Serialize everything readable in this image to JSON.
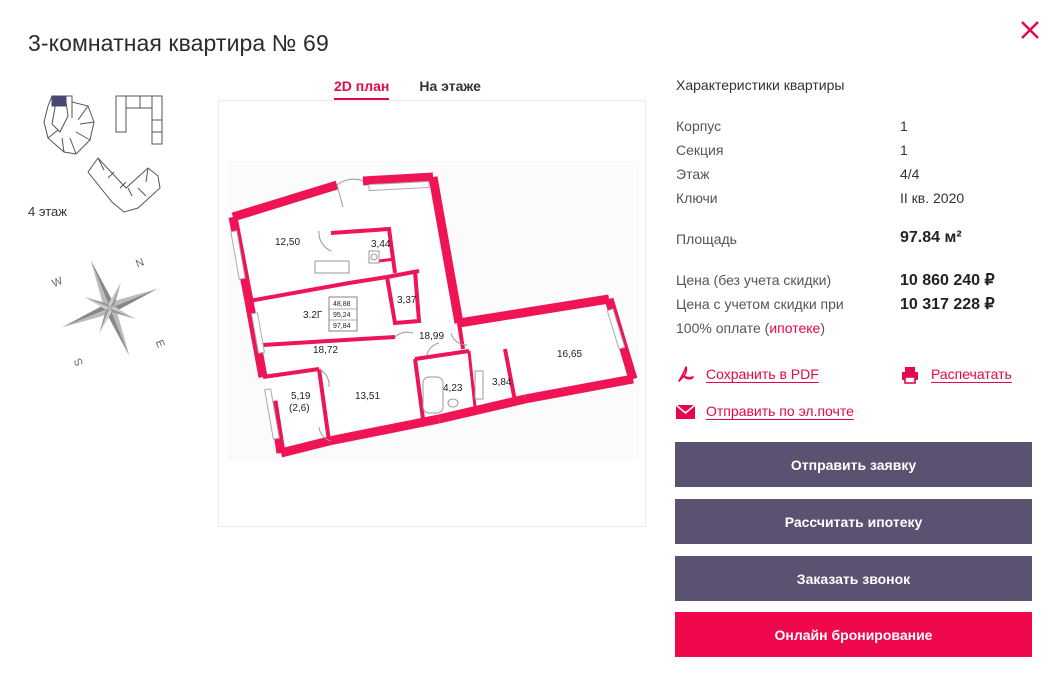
{
  "title": "3-комнатная квартира № 69",
  "floor_label": "4 этаж",
  "tabs": [
    {
      "label": "2D план",
      "active": true
    },
    {
      "label": "На этаже",
      "active": false
    }
  ],
  "compass": {
    "n": "N",
    "e": "E",
    "s": "S",
    "w": "W"
  },
  "plan": {
    "rooms": [
      "12,50",
      "3,44",
      "3,37",
      "18,99",
      "18,72",
      "16,65",
      "4,23",
      "3,84",
      "13,51",
      "5,19",
      "(2,6)"
    ],
    "legend": {
      "type": "3.2Г",
      "values": [
        "48,88",
        "95,24",
        "97,84"
      ]
    }
  },
  "specs": {
    "title": "Характеристики квартиры",
    "rows": [
      {
        "label": "Корпус",
        "value": "1"
      },
      {
        "label": "Секция",
        "value": "1"
      },
      {
        "label": "Этаж",
        "value": "4/4"
      },
      {
        "label": "Ключи",
        "value": "II кв. 2020"
      }
    ],
    "area_label": "Площадь",
    "area_value": "97.84 м²",
    "price_label": "Цена (без учета скидки)",
    "price_value": "10 860 240 ₽",
    "discount_label_1": "Цена с учетом скидки при",
    "discount_label_2": "100% оплате (",
    "discount_link": "ипотеке",
    "discount_label_3": ")",
    "discount_value": "10 317 228 ₽"
  },
  "actions": {
    "pdf": "Сохранить в PDF",
    "print": "Распечатать",
    "email": "Отправить по эл.почте"
  },
  "buttons": {
    "request": "Отправить заявку",
    "mortgage": "Рассчитать ипотеку",
    "callback": "Заказать звонок",
    "booking": "Онлайн бронирование"
  },
  "colors": {
    "accent": "#e4074c",
    "button_dark": "#5b5171",
    "button_pink": "#f0084c",
    "wall": "#ee1455"
  }
}
